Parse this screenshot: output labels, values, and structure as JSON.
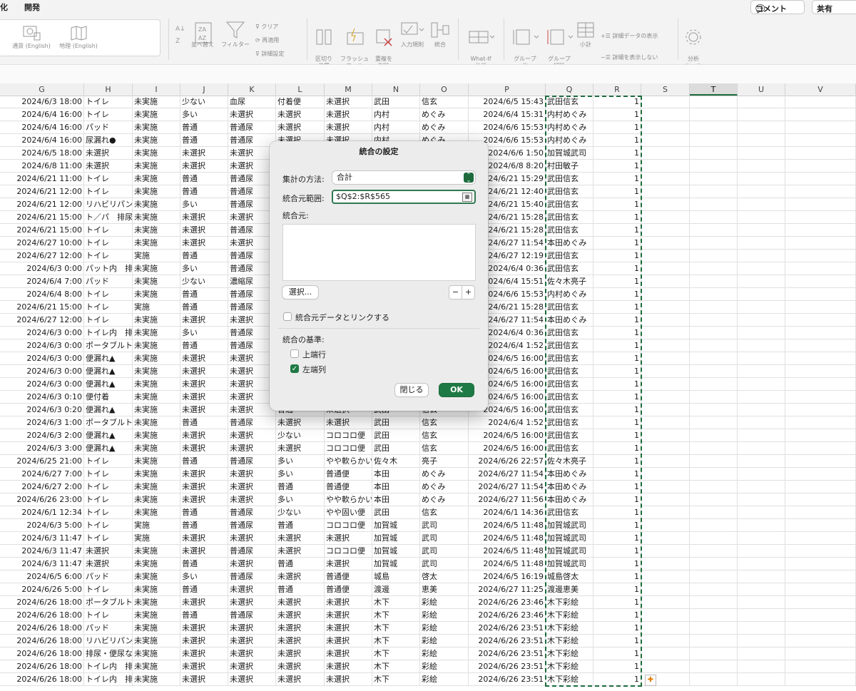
{
  "menu": {
    "item1": "化",
    "item2": "開発"
  },
  "topbar": {
    "comment_label": "コメント",
    "share_label": "共有"
  },
  "ribbon": {
    "datatype1": "通貨 (English)",
    "datatype2": "地理 (English)",
    "sort": "並べ替え",
    "filter": "フィルター",
    "clear": "クリア",
    "reapply": "再適用",
    "advanced": "詳細設定",
    "text_to_columns": "区切り\n位置",
    "flash_fill": "フラッシュ\nフィル",
    "remove_dup": "重複を\n削除",
    "validation": "入力規則",
    "consolidate": "統合",
    "whatif": "What-If\n分析",
    "group": "グループ\n化",
    "ungroup": "グループ\n解除",
    "subtotal": "小計",
    "show_detail": "詳細データの表示",
    "hide_detail": "詳細を表示しない",
    "analysis": "分析\nツール"
  },
  "columns": [
    "G",
    "H",
    "I",
    "J",
    "K",
    "L",
    "M",
    "N",
    "O",
    "P",
    "Q",
    "R",
    "S",
    "T",
    "U",
    "V"
  ],
  "selected_column": "T",
  "rows": [
    [
      "2024/6/3 18:00",
      "トイレ",
      "未実施",
      "少ない",
      "血尿",
      "付着便",
      "未選択",
      "武田",
      "信玄",
      "2024/6/5 15:43",
      "武田信玄",
      "1"
    ],
    [
      "2024/6/4 16:00",
      "トイレ",
      "未実施",
      "多い",
      "未選択",
      "未選択",
      "未選択",
      "内村",
      "めぐみ",
      "2024/6/4 15:31",
      "内村めぐみ",
      "1"
    ],
    [
      "2024/6/4 16:00",
      "パッド",
      "未実施",
      "普通",
      "普通尿",
      "未選択",
      "未選択",
      "内村",
      "めぐみ",
      "2024/6/6 15:53",
      "内村めぐみ",
      "1"
    ],
    [
      "2024/6/4 16:00",
      "尿漏れ●",
      "未実施",
      "普通",
      "普通尿",
      "未選択",
      "未選択",
      "内村",
      "めぐみ",
      "2024/6/6 15:53",
      "内村めぐみ",
      "1"
    ],
    [
      "2024/6/5 18:00",
      "未選択",
      "未実施",
      "未選択",
      "未選択",
      "",
      "",
      "",
      "",
      "2024/6/6 1:50",
      "加賀城武司",
      "1"
    ],
    [
      "2024/6/8 11:00",
      "未選択",
      "未実施",
      "未選択",
      "未選択",
      "",
      "",
      "",
      "",
      "2024/6/8 8:20",
      "村田敏子",
      "1"
    ],
    [
      "2024/6/21 11:00",
      "トイレ",
      "未実施",
      "普通",
      "普通尿",
      "",
      "",
      "",
      "",
      "2024/6/21 15:29",
      "武田信玄",
      "1"
    ],
    [
      "2024/6/21 12:00",
      "トイレ",
      "未実施",
      "普通",
      "普通尿",
      "",
      "",
      "",
      "",
      "2024/6/21 12:40",
      "武田信玄",
      "1"
    ],
    [
      "2024/6/21 12:00",
      "リハビリパン",
      "未実施",
      "多い",
      "普通尿",
      "",
      "",
      "",
      "",
      "2024/6/21 15:40",
      "武田信玄",
      "1"
    ],
    [
      "2024/6/21 15:00",
      "ト／パ　排尿",
      "未実施",
      "未選択",
      "未選択",
      "",
      "",
      "",
      "",
      "2024/6/21 15:28",
      "武田信玄",
      "1"
    ],
    [
      "2024/6/21 15:00",
      "トイレ",
      "未実施",
      "未選択",
      "普通尿",
      "",
      "",
      "",
      "",
      "2024/6/21 15:28",
      "武田信玄",
      "1"
    ],
    [
      "2024/6/27 10:00",
      "トイレ",
      "未実施",
      "未選択",
      "未選択",
      "",
      "",
      "",
      "",
      "2024/6/27 11:54",
      "本田めぐみ",
      "1"
    ],
    [
      "2024/6/27 12:00",
      "トイレ",
      "実施",
      "普通",
      "普通尿",
      "",
      "",
      "",
      "",
      "2024/6/27 12:19",
      "武田信玄",
      "1"
    ],
    [
      "2024/6/3 0:00",
      "パット内　排",
      "未実施",
      "多い",
      "普通尿",
      "",
      "",
      "",
      "",
      "2024/6/4 0:36",
      "武田信玄",
      "1"
    ],
    [
      "2024/6/4 7:00",
      "パッド",
      "未実施",
      "少ない",
      "濃縮尿",
      "",
      "",
      "",
      "",
      "2024/6/4 15:51",
      "佐々木亮子",
      "1"
    ],
    [
      "2024/6/4 8:00",
      "トイレ",
      "未実施",
      "普通",
      "普通尿",
      "",
      "",
      "",
      "",
      "2024/6/6 15:53",
      "内村めぐみ",
      "1"
    ],
    [
      "2024/6/21 15:00",
      "トイレ",
      "実施",
      "普通",
      "普通尿",
      "",
      "",
      "",
      "",
      "2024/6/21 15:28",
      "武田信玄",
      "1"
    ],
    [
      "2024/6/27 12:00",
      "トイレ",
      "未実施",
      "未選択",
      "未選択",
      "",
      "",
      "",
      "",
      "2024/6/27 11:54",
      "本田めぐみ",
      "1"
    ],
    [
      "2024/6/3 0:00",
      "トイレ内　排",
      "未実施",
      "多い",
      "普通尿",
      "",
      "",
      "",
      "",
      "2024/6/4 0:36",
      "武田信玄",
      "1"
    ],
    [
      "2024/6/3 0:00",
      "ポータブルト",
      "未実施",
      "普通",
      "普通尿",
      "",
      "",
      "",
      "",
      "2024/6/4 1:52",
      "武田信玄",
      "1"
    ],
    [
      "2024/6/3 0:00",
      "便漏れ▲",
      "未実施",
      "未選択",
      "未選択",
      "",
      "",
      "",
      "",
      "2024/6/5 16:00",
      "武田信玄",
      "1"
    ],
    [
      "2024/6/3 0:00",
      "便漏れ▲",
      "未実施",
      "未選択",
      "未選択",
      "",
      "",
      "",
      "",
      "2024/6/5 16:00",
      "武田信玄",
      "1"
    ],
    [
      "2024/6/3 0:00",
      "便漏れ▲",
      "未実施",
      "未選択",
      "未選択",
      "",
      "",
      "",
      "",
      "2024/6/5 16:00",
      "武田信玄",
      "1"
    ],
    [
      "2024/6/3 0:10",
      "便付着",
      "未実施",
      "未選択",
      "未選択",
      "",
      "",
      "",
      "",
      "2024/6/5 16:00",
      "武田信玄",
      "1"
    ],
    [
      "2024/6/3 0:20",
      "便漏れ▲",
      "未実施",
      "未選択",
      "未選択",
      "普通",
      "未選択",
      "武田",
      "信玄",
      "2024/6/5 16:00",
      "武田信玄",
      "1"
    ],
    [
      "2024/6/3 1:00",
      "ポータブルト",
      "未実施",
      "普通",
      "普通尿",
      "未選択",
      "未選択",
      "武田",
      "信玄",
      "2024/6/4 1:52",
      "武田信玄",
      "1"
    ],
    [
      "2024/6/3 2:00",
      "便漏れ▲",
      "未実施",
      "未選択",
      "未選択",
      "少ない",
      "コロコロ便",
      "武田",
      "信玄",
      "2024/6/5 16:00",
      "武田信玄",
      "1"
    ],
    [
      "2024/6/3 3:00",
      "便漏れ▲",
      "未実施",
      "未選択",
      "未選択",
      "未選択",
      "コロコロ便",
      "武田",
      "信玄",
      "2024/6/5 16:00",
      "武田信玄",
      "1"
    ],
    [
      "2024/6/25 21:00",
      "トイレ",
      "未実施",
      "普通",
      "普通尿",
      "多い",
      "やや軟らかい",
      "佐々木",
      "亮子",
      "2024/6/26 22:57",
      "佐々木亮子",
      "1"
    ],
    [
      "2024/6/27 7:00",
      "トイレ",
      "未実施",
      "未選択",
      "未選択",
      "多い",
      "普通便",
      "本田",
      "めぐみ",
      "2024/6/27 11:54",
      "本田めぐみ",
      "1"
    ],
    [
      "2024/6/27 2:00",
      "トイレ",
      "未実施",
      "未選択",
      "未選択",
      "普通",
      "普通便",
      "本田",
      "めぐみ",
      "2024/6/27 11:54",
      "本田めぐみ",
      "1"
    ],
    [
      "2024/6/26 23:00",
      "トイレ",
      "未実施",
      "未選択",
      "未選択",
      "多い",
      "やや軟らかい",
      "本田",
      "めぐみ",
      "2024/6/27 11:56",
      "本田めぐみ",
      "1"
    ],
    [
      "2024/6/1 12:34",
      "トイレ",
      "未実施",
      "普通",
      "普通尿",
      "少ない",
      "やや固い便",
      "武田",
      "信玄",
      "2024/6/1 14:36",
      "武田信玄",
      "1"
    ],
    [
      "2024/6/3 5:00",
      "トイレ",
      "実施",
      "普通",
      "普通尿",
      "普通",
      "コロコロ便",
      "加賀城",
      "武司",
      "2024/6/5 11:48",
      "加賀城武司",
      "1"
    ],
    [
      "2024/6/3 11:47",
      "トイレ",
      "実施",
      "未選択",
      "未選択",
      "未選択",
      "未選択",
      "加賀城",
      "武司",
      "2024/6/5 11:48",
      "加賀城武司",
      "1"
    ],
    [
      "2024/6/3 11:47",
      "未選択",
      "未実施",
      "未選択",
      "普通尿",
      "未選択",
      "コロコロ便",
      "加賀城",
      "武司",
      "2024/6/5 11:48",
      "加賀城武司",
      "1"
    ],
    [
      "2024/6/3 11:47",
      "未選択",
      "未実施",
      "普通",
      "未選択",
      "普通",
      "未選択",
      "加賀城",
      "武司",
      "2024/6/5 11:48",
      "加賀城武司",
      "1"
    ],
    [
      "2024/6/5 6:00",
      "パッド",
      "未実施",
      "多い",
      "普通尿",
      "未選択",
      "普通便",
      "城島",
      "啓太",
      "2024/6/5 16:19",
      "城島啓太",
      "1"
    ],
    [
      "2024/6/26 5:00",
      "トイレ",
      "未実施",
      "普通",
      "未選択",
      "普通",
      "普通便",
      "渡邊",
      "恵美",
      "2024/6/27 11:25",
      "渡邊恵美",
      "1"
    ],
    [
      "2024/6/26 18:00",
      "ポータブルト",
      "未実施",
      "未選択",
      "未選択",
      "未選択",
      "未選択",
      "木下",
      "彩絵",
      "2024/6/26 23:46",
      "木下彩絵",
      "1"
    ],
    [
      "2024/6/26 18:00",
      "トイレ",
      "未実施",
      "普通",
      "普通尿",
      "未選択",
      "未選択",
      "木下",
      "彩絵",
      "2024/6/26 23:46",
      "木下彩絵",
      "1"
    ],
    [
      "2024/6/26 18:00",
      "パッド",
      "未実施",
      "未選択",
      "未選択",
      "未選択",
      "未選択",
      "木下",
      "彩絵",
      "2024/6/26 23:51",
      "木下彩絵",
      "1"
    ],
    [
      "2024/6/26 18:00",
      "リハビリパン",
      "未実施",
      "未選択",
      "未選択",
      "未選択",
      "未選択",
      "木下",
      "彩絵",
      "2024/6/26 23:51",
      "木下彩絵",
      "1"
    ],
    [
      "2024/6/26 18:00",
      "排尿・便尿な",
      "未実施",
      "未選択",
      "未選択",
      "未選択",
      "未選択",
      "木下",
      "彩絵",
      "2024/6/26 23:51",
      "木下彩絵",
      "1"
    ],
    [
      "2024/6/26 18:00",
      "トイレ内　排",
      "未実施",
      "未選択",
      "未選択",
      "未選択",
      "未選択",
      "木下",
      "彩絵",
      "2024/6/26 23:51",
      "木下彩絵",
      "1"
    ],
    [
      "2024/6/26 18:00",
      "トイレ内　排",
      "未実施",
      "未選択",
      "未選択",
      "未選択",
      "未選択",
      "木下",
      "彩絵",
      "2024/6/26 23:51",
      "木下彩絵",
      "1"
    ]
  ],
  "dialog": {
    "title": "統合の設定",
    "function_label": "集計の方法:",
    "function_value": "合計",
    "reference_label": "統合元範囲:",
    "reference_value": "$Q$2:$R$565",
    "all_refs_label": "統合元:",
    "browse_label": "選択...",
    "minus": "−",
    "plus": "+",
    "link_label": "統合元データとリンクする",
    "labels_in_label": "統合の基準:",
    "top_row_label": "上端行",
    "left_column_label": "左端列",
    "top_row_checked": false,
    "left_column_checked": true,
    "link_checked": false,
    "close_label": "閉じる",
    "ok_label": "OK"
  },
  "accent": "#1e7a45"
}
